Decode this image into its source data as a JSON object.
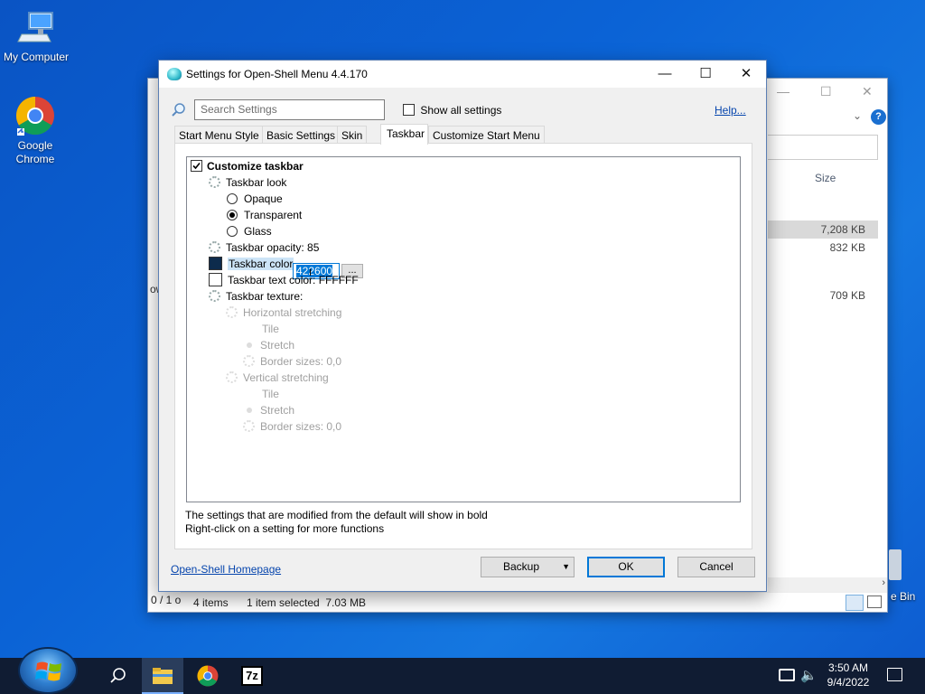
{
  "desktop": {
    "icons": [
      {
        "label": "My Computer",
        "icon": "computer-icon"
      },
      {
        "label": "Google\nChrome",
        "icon": "chrome-icon"
      }
    ],
    "recycle_label": "e Bin"
  },
  "explorer": {
    "column_size": "Size",
    "sizes": [
      "7,208 KB",
      "832 KB",
      "709 KB"
    ],
    "status_items": "4 items",
    "status_selected": "1 item selected  7.03 MB",
    "left_status": "0 / 1 o",
    "left_frag": "ow"
  },
  "dialog": {
    "title": "Settings for Open-Shell Menu 4.4.170",
    "search_placeholder": "Search Settings",
    "show_all": "Show all settings",
    "help": "Help...",
    "tabs": [
      "Start Menu Style",
      "Basic Settings",
      "Skin",
      "Taskbar",
      "Customize Start Menu"
    ],
    "active_tab": "Taskbar",
    "tree": {
      "customize_taskbar": "Customize taskbar",
      "taskbar_look": "Taskbar look",
      "opaque": "Opaque",
      "transparent": "Transparent",
      "glass": "Glass",
      "opacity": "Taskbar opacity: 85",
      "color": "Taskbar color",
      "color_value": "422600",
      "color_swatch": "#0d2b4c",
      "text_color": "Taskbar text color: FFFFFF",
      "texture": "Taskbar texture:",
      "horizontal": "Horizontal stretching",
      "tile": "Tile",
      "stretch": "Stretch",
      "border_sizes": "Border sizes: 0,0",
      "vertical": "Vertical stretching"
    },
    "dots": "...",
    "note1": "The settings that are modified from the default will show in bold",
    "note2": "Right-click on a setting for more functions",
    "homepage": "Open-Shell Homepage",
    "backup": "Backup",
    "ok": "OK",
    "cancel": "Cancel"
  },
  "taskbar": {
    "time": "3:50 AM",
    "date": "9/4/2022",
    "app_7z": "7z"
  }
}
